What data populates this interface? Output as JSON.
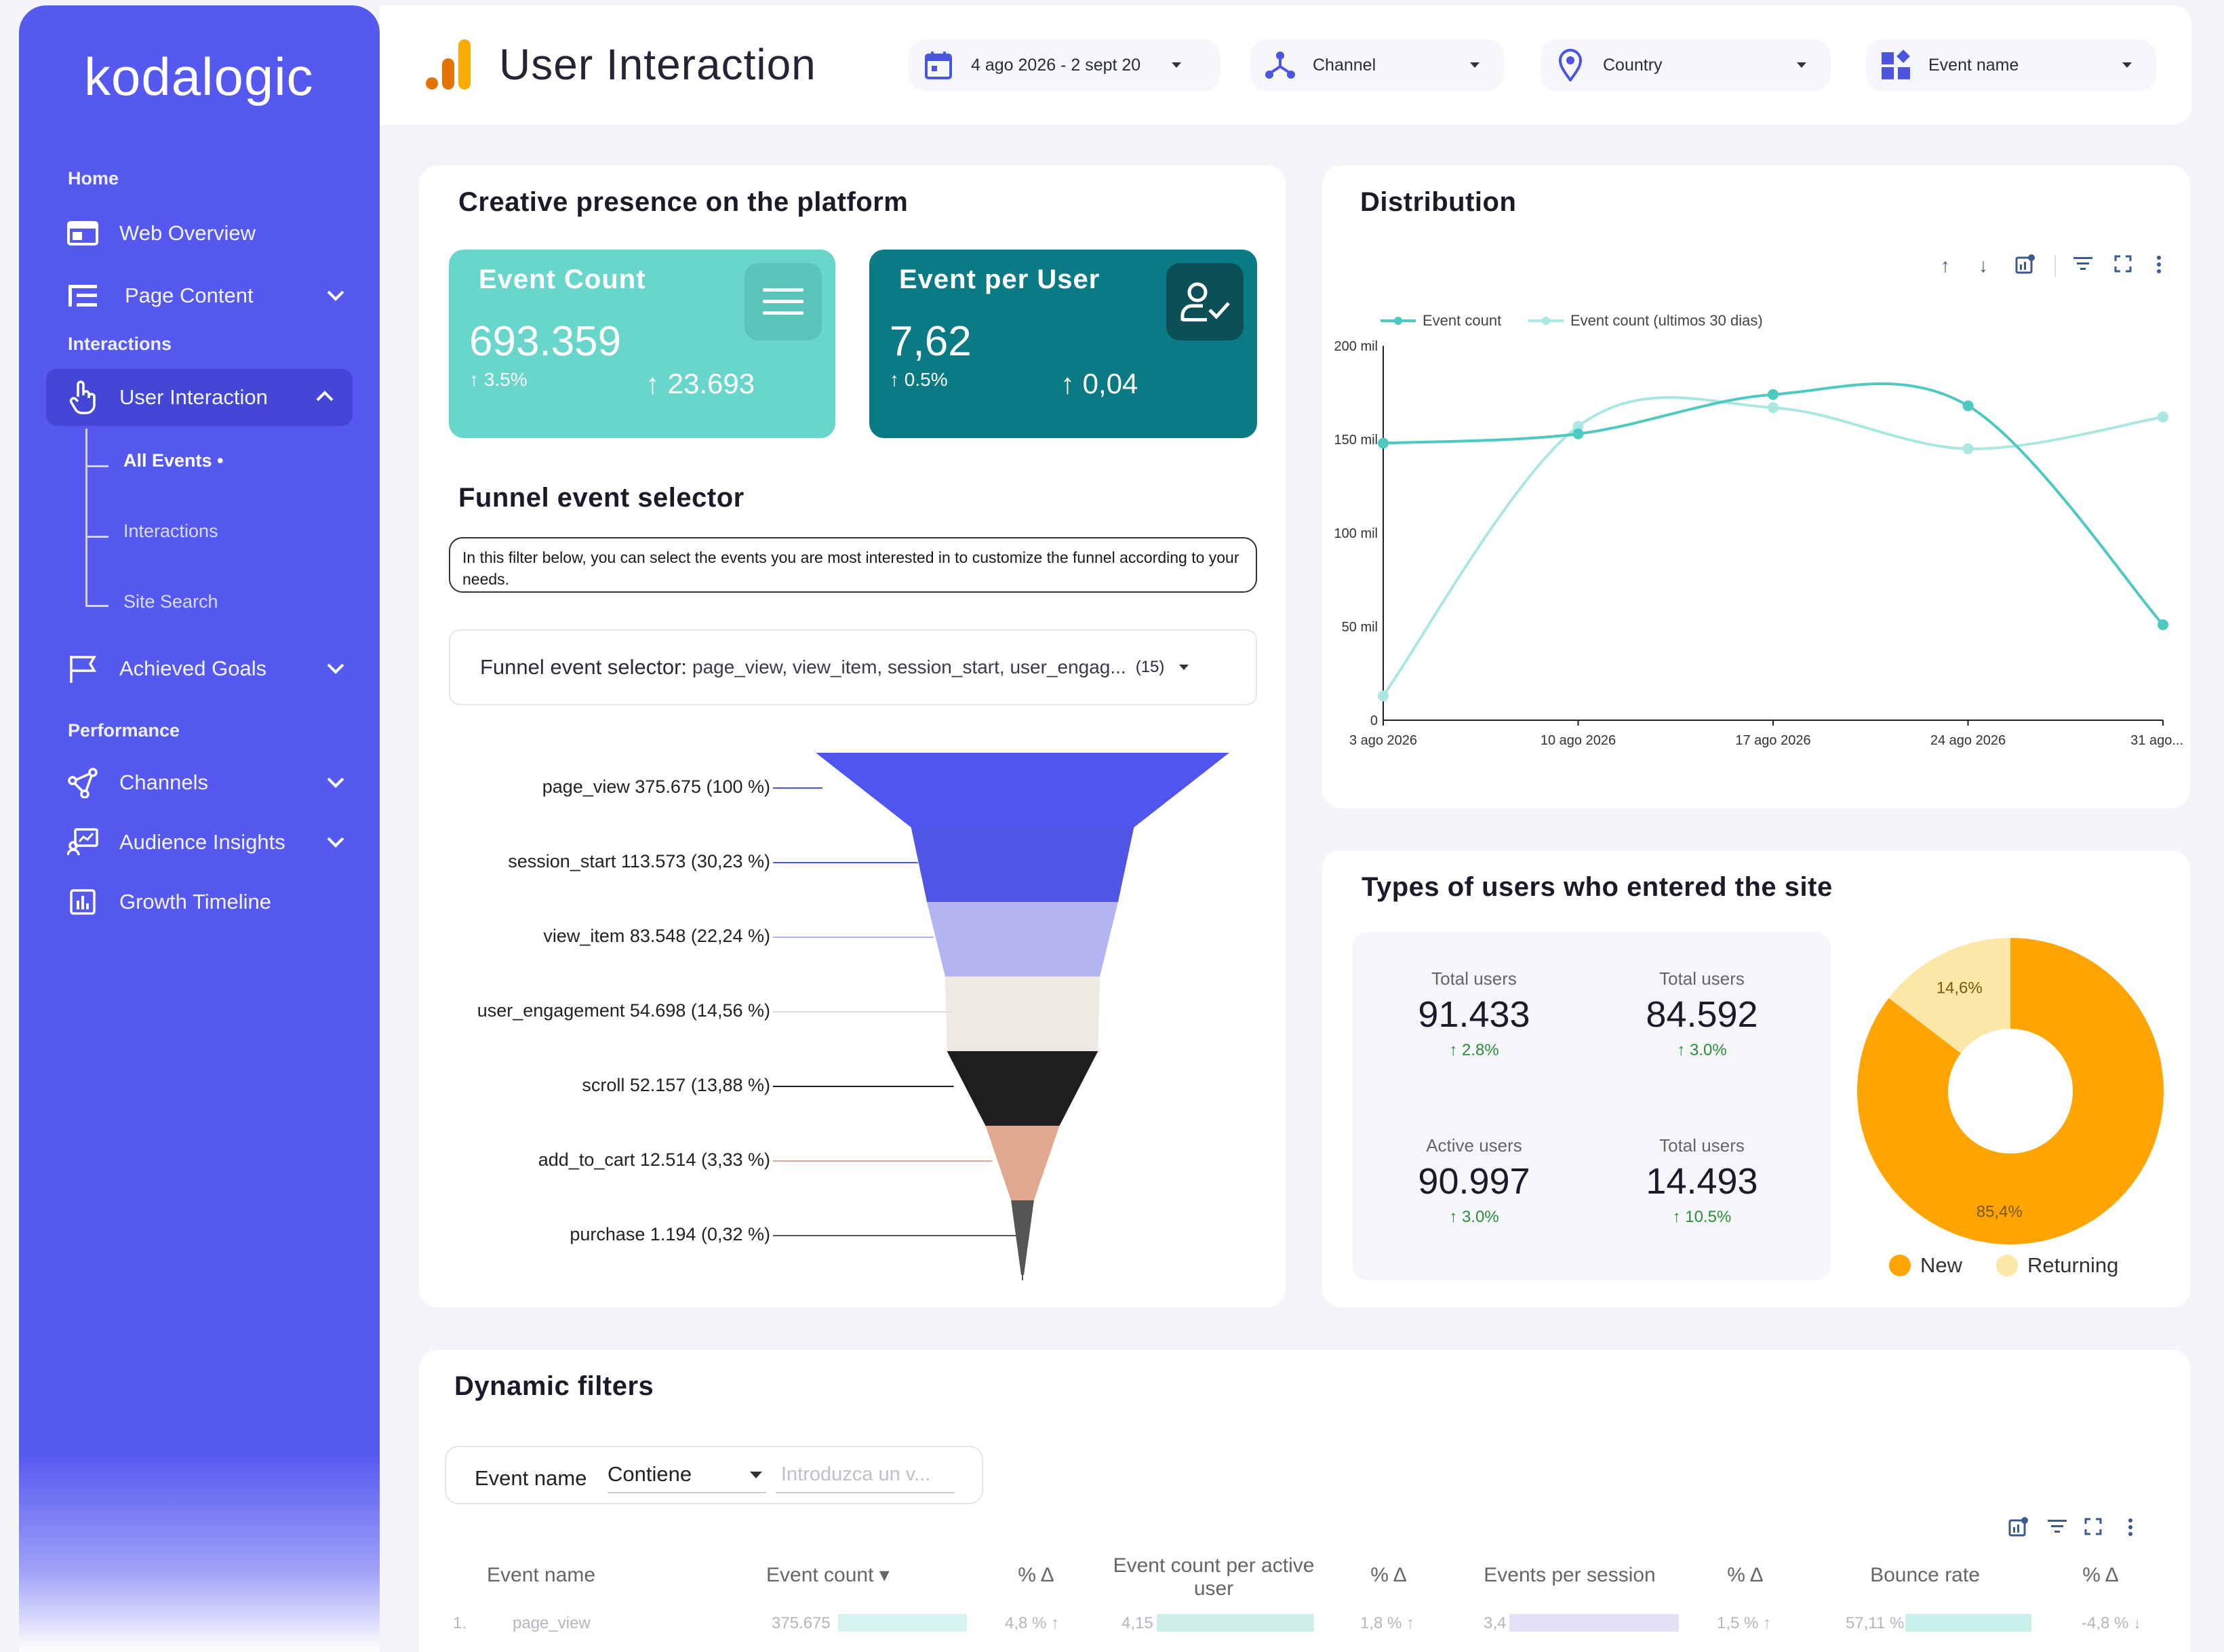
{
  "sidebar": {
    "logo": "kodalogic",
    "sections": {
      "home": "Home",
      "interactions": "Interactions",
      "performance": "Performance"
    },
    "items": {
      "web_overview": "Web Overview",
      "page_content": "Page Content",
      "user_interaction": "User Interaction",
      "achieved_goals": "Achieved Goals",
      "channels": "Channels",
      "audience_insights": "Audience Insights",
      "growth_timeline": "Growth Timeline"
    },
    "subitems": {
      "all_events": "All Events •",
      "interactions": "Interactions",
      "site_search": "Site Search"
    }
  },
  "header": {
    "title": "User Interaction",
    "date_range": "4 ago 2026 - 2 sept 20",
    "channel": "Channel",
    "country": "Country",
    "event_name": "Event name"
  },
  "creative": {
    "title": "Creative presence on the platform",
    "event_count": {
      "label": "Event Count",
      "value": "693.359",
      "pct": "3.5%",
      "sub": "23.693"
    },
    "event_per_user": {
      "label": "Event per User",
      "value": "7,62",
      "pct": "0.5%",
      "sub": "0,04"
    }
  },
  "funnel": {
    "title": "Funnel event selector",
    "note": "In this filter below, you can select the events you are most interested in to customize the funnel according to your needs.",
    "selector_label": "Funnel event selector:",
    "selector_value": "page_view, view_item, session_start, user_engag...",
    "selector_count": "(15)",
    "stages": [
      {
        "label": "page_view 375.675 (100 %)",
        "value": 375675,
        "pct": 100,
        "color": "#5155f0"
      },
      {
        "label": "session_start 113.573 (30,23 %)",
        "value": 113573,
        "pct": 30.23,
        "color": "#5155e6"
      },
      {
        "label": "view_item 83.548 (22,24 %)",
        "value": 83548,
        "pct": 22.24,
        "color": "#b3b5f2"
      },
      {
        "label": "user_engagement 54.698 (14,56 %)",
        "value": 54698,
        "pct": 14.56,
        "color": "#efe9e3"
      },
      {
        "label": "scroll 52.157 (13,88 %)",
        "value": 52157,
        "pct": 13.88,
        "color": "#1e1e1e"
      },
      {
        "label": "add_to_cart 12.514 (3,33 %)",
        "value": 12514,
        "pct": 3.33,
        "color": "#e0a98f"
      },
      {
        "label": "purchase 1.194 (0,32 %)",
        "value": 1194,
        "pct": 0.32,
        "color": "#555"
      }
    ]
  },
  "distribution": {
    "title": "Distribution",
    "legend": [
      "Event count",
      "Event count (ultimos 30 dias)"
    ]
  },
  "chart_data": {
    "type": "line",
    "x": [
      "3 ago 2026",
      "10 ago 2026",
      "17 ago 2026",
      "24 ago 2026",
      "31 ago..."
    ],
    "series": [
      {
        "name": "Event count",
        "values": [
          148,
          153,
          174,
          168,
          51
        ]
      },
      {
        "name": "Event count (ultimos 30 dias)",
        "values": [
          13,
          157,
          167,
          145,
          162
        ]
      }
    ],
    "y_ticks": [
      "0",
      "50 mil",
      "100 mil",
      "150 mil",
      "200 mil"
    ],
    "ylim": [
      0,
      200
    ],
    "colors": [
      "#4cc9c0",
      "#a9e7e0"
    ]
  },
  "users": {
    "title": "Types of users who entered the site",
    "stats": [
      {
        "label": "Total users",
        "value": "91.433",
        "pct": "2.8%"
      },
      {
        "label": "Total users",
        "value": "84.592",
        "pct": "3.0%"
      },
      {
        "label": "Active users",
        "value": "90.997",
        "pct": "3.0%"
      },
      {
        "label": "Total users",
        "value": "14.493",
        "pct": "10.5%"
      }
    ],
    "pie": [
      {
        "name": "New",
        "value": 85.4,
        "label": "85,4%",
        "color": "#ffa400"
      },
      {
        "name": "Returning",
        "value": 14.6,
        "label": "14,6%",
        "color": "#fde7a8"
      }
    ]
  },
  "dynamic": {
    "title": "Dynamic filters",
    "filter_label": "Event name",
    "filter_op": "Contiene",
    "filter_placeholder": "Introduzca un v...",
    "columns": [
      "Event name",
      "Event count ▾",
      "% Δ",
      "Event count per active user",
      "% Δ",
      "Events per session",
      "% Δ",
      "Bounce rate",
      "% Δ"
    ],
    "row": {
      "idx": "1.",
      "name": "page_view",
      "count": "375.675",
      "count_d": "4,8 % ↑",
      "per_user": "4,15",
      "per_user_d": "1,8 % ↑",
      "per_session": "3,4",
      "per_session_d": "1,5 % ↑",
      "bounce": "57,11 %",
      "bounce_d": "-4,8 % ↓"
    }
  }
}
